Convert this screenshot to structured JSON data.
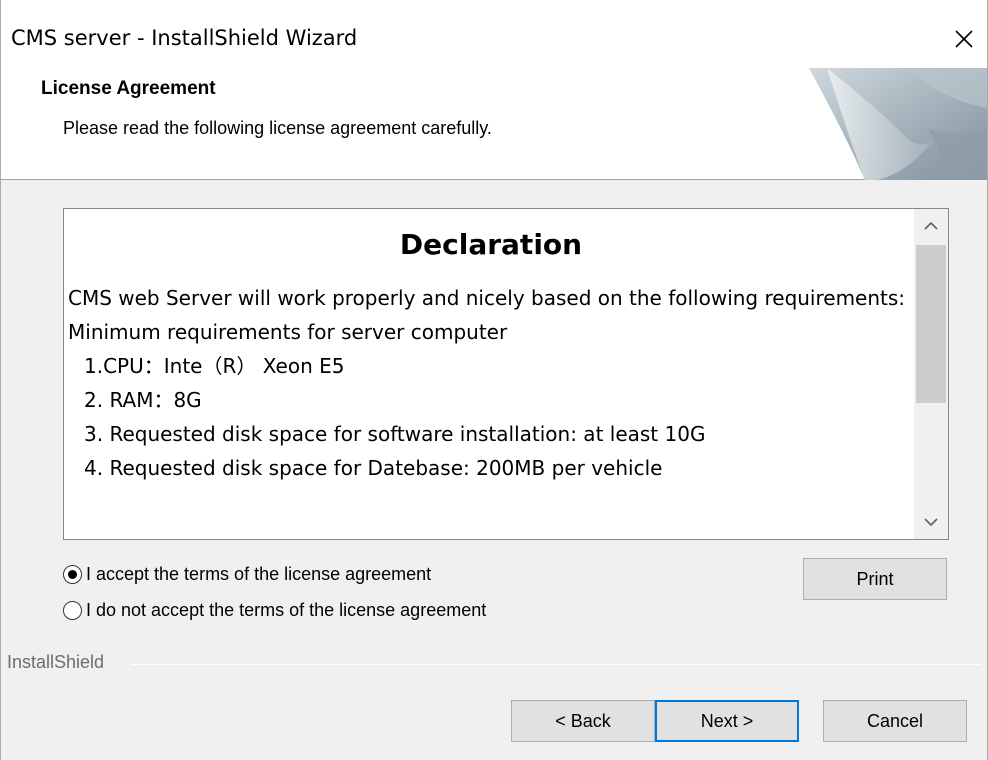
{
  "window": {
    "title": "CMS server - InstallShield Wizard"
  },
  "header": {
    "title": "License Agreement",
    "subtitle": "Please read the following license agreement carefully."
  },
  "license": {
    "heading": "Declaration",
    "paragraph_1": "CMS web Server will work properly and nicely based on the following requirements:",
    "paragraph_2": "Minimum requirements for server computer",
    "items": [
      "1.CPU：Inte（R） Xeon E5",
      "2. RAM：8G",
      "3. Requested disk space for software installation: at least 10G",
      "4. Requested disk space for Datebase: 200MB per vehicle"
    ]
  },
  "options": {
    "accept_label": "I accept the terms of the license agreement",
    "decline_label": "I do not accept the terms of the license agreement",
    "selected": "accept"
  },
  "buttons": {
    "print": "Print",
    "back": "< Back",
    "next": "Next >",
    "cancel": "Cancel"
  },
  "footer": {
    "brand": "InstallShield"
  },
  "icons": {
    "close": "close-icon",
    "scroll_up": "chevron-up-icon",
    "scroll_down": "chevron-down-icon",
    "header_graphic": "page-curl-graphic"
  },
  "colors": {
    "default_button_border": "#0078d7",
    "window_background": "#f0f0f0"
  }
}
